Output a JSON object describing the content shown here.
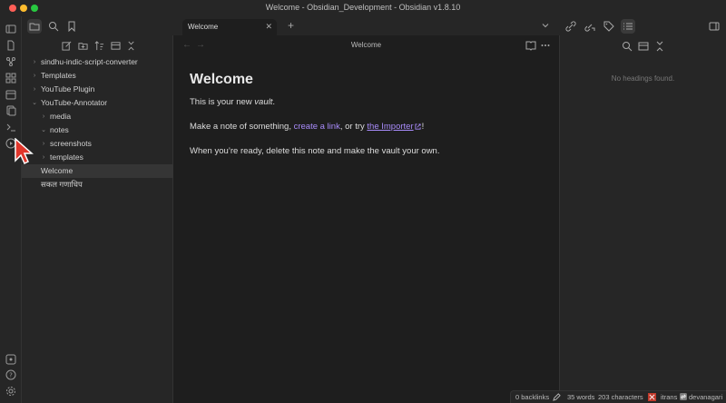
{
  "window": {
    "title": "Welcome - Obsidian_Development - Obsidian v1.8.10"
  },
  "ribbon": {
    "icons": [
      "sidebar-toggle-icon",
      "files-icon",
      "graph-icon",
      "canvas-icon",
      "calendar-icon",
      "templates-icon",
      "terminal-icon",
      "play-icon",
      "vault-icon",
      "help-icon",
      "settings-icon"
    ]
  },
  "sidebar": {
    "header_icons": [
      "folder-icon",
      "search-icon",
      "bookmark-icon"
    ],
    "toolbar_icons": [
      "new-note-icon",
      "new-folder-icon",
      "sort-icon",
      "collapse-icon",
      "close-icon"
    ],
    "tree": [
      {
        "label": "sindhu-indic-script-converter",
        "depth": 0,
        "type": "folder"
      },
      {
        "label": "Templates",
        "depth": 0,
        "type": "folder"
      },
      {
        "label": "YouTube Plugin",
        "depth": 0,
        "type": "folder"
      },
      {
        "label": "YouTube-Annotator",
        "depth": 0,
        "type": "folder-open"
      },
      {
        "label": "media",
        "depth": 1,
        "type": "folder"
      },
      {
        "label": "notes",
        "depth": 1,
        "type": "folder-open"
      },
      {
        "label": "screenshots",
        "depth": 1,
        "type": "folder"
      },
      {
        "label": "templates",
        "depth": 1,
        "type": "folder"
      },
      {
        "label": "Welcome",
        "depth": 0,
        "type": "file",
        "selected": true
      },
      {
        "label": "सकल गणाधिप",
        "depth": 0,
        "type": "file"
      }
    ]
  },
  "tabs": {
    "active_title": "Welcome",
    "close_glyph": "✕",
    "new_tab_glyph": "+"
  },
  "editor": {
    "view_title": "Welcome",
    "heading": "Welcome",
    "p1_prefix": "This is your new ",
    "p1_emph": "vault",
    "p1_suffix": ".",
    "p2_prefix": "Make a note of something, ",
    "p2_link1": "create a link",
    "p2_mid": ", or try ",
    "p2_link2": "the Importer",
    "p2_suffix": "!",
    "p3": "When you’re ready, delete this note and make the vault your own."
  },
  "right_panel": {
    "empty_message": "No headings found."
  },
  "statusbar": {
    "backlinks": "0 backlinks",
    "words": "35 words",
    "characters": "203 characters",
    "script_from": "itrans",
    "script_to": "devanagari"
  },
  "colors": {
    "accent": "#a88bfa",
    "background": "#1e1e1e",
    "panel": "#262626"
  }
}
